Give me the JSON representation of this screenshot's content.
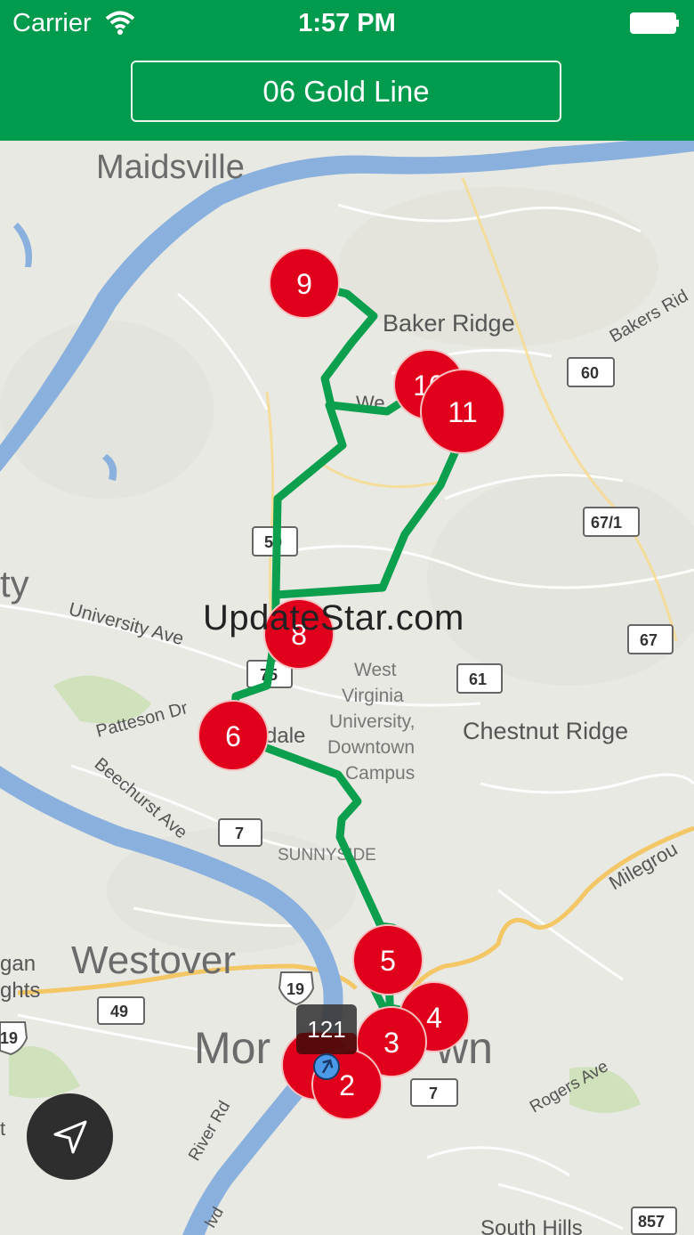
{
  "status_bar": {
    "carrier": "Carrier",
    "time": "1:57 PM"
  },
  "header": {
    "route_label": "06 Gold Line"
  },
  "map": {
    "place_labels": {
      "maidsville": "Maidsville",
      "baker_ridge": "Baker Ridge",
      "bakers_ridge_rd": "Bakers Rid",
      "university_ave": "University Ave",
      "patteson_dr": "Patteson Dr",
      "beechurst_ave": "Beechurst Ave",
      "wvu_line1": "West",
      "wvu_line2": "Virginia",
      "wvu_line3": "University,",
      "wvu_line4": "Downtown",
      "wvu_line5": "Campus",
      "chestnut_ridge": "Chestnut Ridge",
      "sunnyside": "SUNNYSIDE",
      "westover": "Westover",
      "morgantown_start": "Mor",
      "morgantown_end": "wn",
      "milegrove": "Milegrou",
      "rogers_ave": "Rogers Ave",
      "river_rd": "River Rd",
      "south_hills": "South Hills",
      "city_fragment": "ty",
      "gan": "gan",
      "hts": "ghts",
      "t_fragment": "t",
      "blvd": "lvd",
      "dale": "dale",
      "w_fragment": "We"
    },
    "road_shields": {
      "r60": "60",
      "r67_1": "67/1",
      "r67": "67",
      "r61": "61",
      "r50": "50",
      "r7_a": "7",
      "r7_b": "7",
      "r19": "19",
      "r49": "49",
      "r19_left": "19",
      "r857": "857",
      "r7_c": "75"
    },
    "stops": [
      "9",
      "10",
      "11",
      "8",
      "6",
      "5",
      "4",
      "3",
      "2"
    ],
    "vehicle_label": "121",
    "colors": {
      "route": "#0ca04e",
      "stop": "#e0001b",
      "river": "#8ab0dd",
      "header": "#009b4c"
    }
  },
  "watermark": "UpdateStar.com"
}
